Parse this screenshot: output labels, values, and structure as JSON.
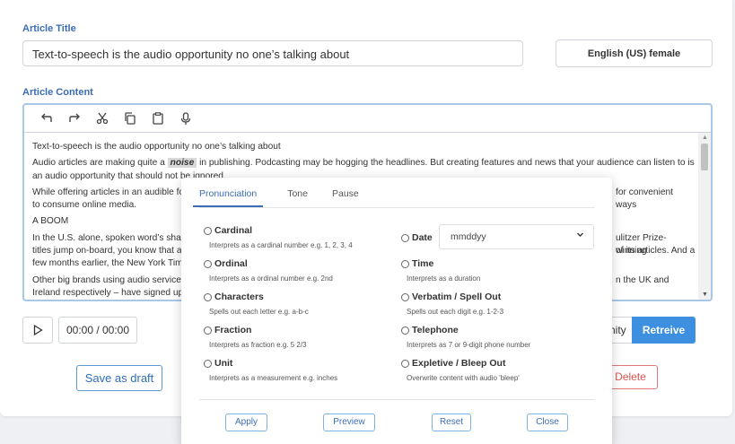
{
  "article": {
    "title_label": "Article Title",
    "title_value": "Text-to-speech is the audio opportunity no one’s talking about",
    "voice": "English (US) female",
    "content_label": "Article Content"
  },
  "editor": {
    "toolbar": [
      "undo-icon",
      "redo-icon",
      "cut-icon",
      "copy-icon",
      "paste-icon",
      "microphone-icon"
    ],
    "lines": {
      "l1": "Text-to-speech is the audio opportunity no one’s talking about",
      "l2a": "Audio articles are making quite a ",
      "l2noise": "noise",
      "l2b": " in publishing. Podcasting may be hogging the headlines. But creating features and news that your audience can listen to is an audio opportunity that should not be ignored.",
      "l3": "While offering articles in an audible for",
      "l3end": "for convenient ways",
      "l3b": "to consume online media.",
      "l4": "A BOOM",
      "l5": "In the U.S. alone,  spoken word’s shar",
      "l5end": "ulitzer Prize-winning",
      "l6": "titles jump on-board, you know that au",
      "l6end": "of its articles. And a",
      "l7": "few months earlier, the New York Time",
      "l8": "Other big brands using audio services",
      "l8end": "n the UK and",
      "l9": "Ireland respectively – have signed up"
    }
  },
  "player": {
    "time": "00:00 / 00:00"
  },
  "buttons": {
    "save": "Save as draft",
    "unity": "nity",
    "retrieve": "Retreive",
    "delete": "Delete"
  },
  "popup": {
    "tabs": {
      "pronunciation": "Pronunciation",
      "tone": "Tone",
      "pause": "Pause"
    },
    "options": {
      "cardinal": {
        "label": "Cardinal",
        "desc": "Interprets as a cardinal number e.g. 1, 2, 3, 4"
      },
      "ordinal": {
        "label": "Ordinal",
        "desc": "Interprets as a ordinal number e.g. 2nd"
      },
      "characters": {
        "label": "Characters",
        "desc": "Spells out each letter e.g. a-b-c"
      },
      "fraction": {
        "label": "Fraction",
        "desc": "Interprets as fraction e.g. 5 2/3"
      },
      "unit": {
        "label": "Unit",
        "desc": "Interprets as a measurement e.g. inches"
      },
      "date": {
        "label": "Date",
        "format": "mmddyy"
      },
      "time": {
        "label": "Time",
        "desc": "Interprets as a duration"
      },
      "verbatim": {
        "label": "Verbatim / Spell Out",
        "desc": "Spells out each digit e.g. 1-2-3"
      },
      "telephone": {
        "label": "Telephone",
        "desc": "Interprets as 7 or 9-digit phone number"
      },
      "expletive": {
        "label": "Expletive / Bleep Out",
        "desc": "Overwrite content with audio 'bleep'"
      }
    },
    "actions": {
      "apply": "Apply",
      "preview": "Preview",
      "reset": "Reset",
      "close": "Close"
    }
  },
  "colors": {
    "accent": "#3b6db4",
    "primary_button": "#3d8fe0",
    "danger": "#d9534f"
  }
}
